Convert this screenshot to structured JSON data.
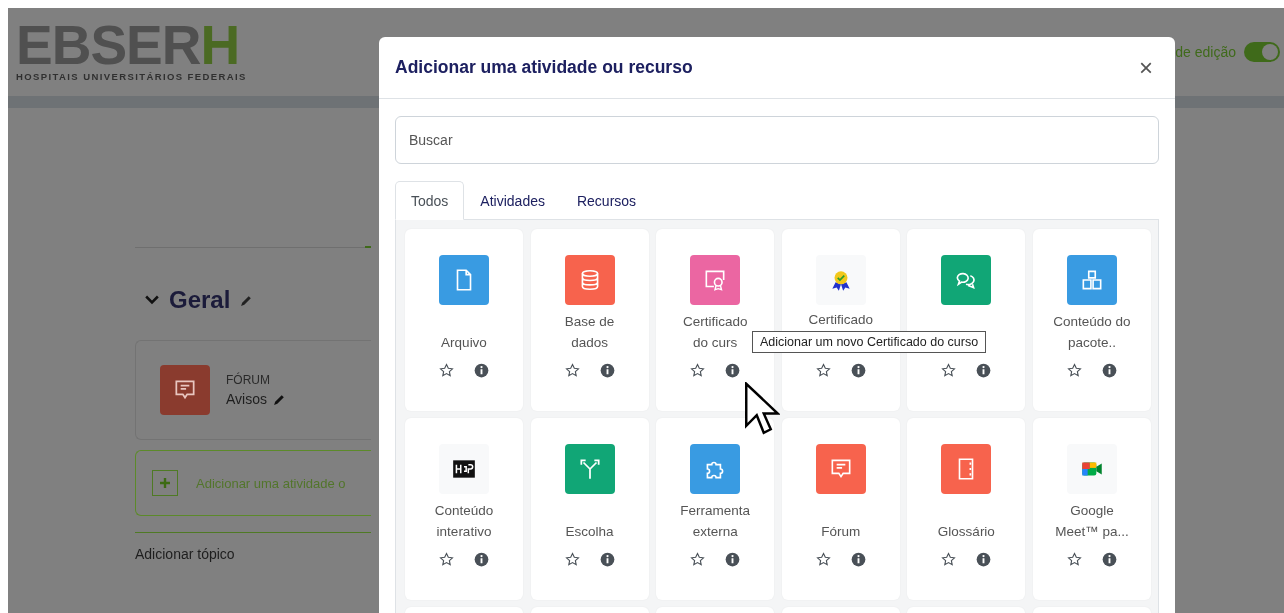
{
  "header": {
    "logo_main": "EBSER",
    "logo_accent": "H",
    "logo_subtitle": "HOSPITAIS UNIVERSITÁRIOS FEDERAIS",
    "edit_mode_label": "de edição",
    "edit_mode_on": true
  },
  "course": {
    "section_title": "Geral",
    "expanded": true,
    "activity": {
      "type": "FÓRUM",
      "name": "Avisos"
    },
    "add_activity": "Adicionar uma atividade o",
    "add_topic": "Adicionar tópico"
  },
  "modal": {
    "title": "Adicionar uma atividade ou recurso",
    "close": "×",
    "search": {
      "placeholder": "Buscar"
    },
    "tabs": [
      {
        "label": "Todos",
        "selected": true
      },
      {
        "label": "Atividades",
        "selected": false
      },
      {
        "label": "Recursos",
        "selected": false
      }
    ],
    "items": [
      {
        "kind": "file",
        "color": "#399be2",
        "name": "Arquivo",
        "favorite": false
      },
      {
        "kind": "database",
        "color": "#f7634d",
        "name": "Base de dados",
        "favorite": false
      },
      {
        "kind": "certificate",
        "color": "#eb66a2",
        "name": "Certificado do curs",
        "favorite": false
      },
      {
        "kind": "badge",
        "color": "#f8f9fa",
        "name": "Certificado",
        "partly_covered": true,
        "favorite": false
      },
      {
        "kind": "chat",
        "color": "#11a676",
        "favorite": false
      },
      {
        "kind": "package",
        "color": "#399be2",
        "name": "Conteúdo do pacote..",
        "favorite": false
      },
      {
        "kind": "h5p",
        "color": "#f8f9fa",
        "name": "Conteúdo interativo",
        "favorite": false
      },
      {
        "kind": "choice",
        "color": "#11a676",
        "name": "Escolha",
        "favorite": false
      },
      {
        "kind": "puzzle",
        "color": "#399be2",
        "name": "Ferramenta externa",
        "favorite": false
      },
      {
        "kind": "forum",
        "color": "#f7634d",
        "name": "Fórum",
        "favorite": false
      },
      {
        "kind": "glossary",
        "color": "#f7634d",
        "name": "Glossário",
        "favorite": false
      },
      {
        "kind": "meet",
        "color": "#f8f9fa",
        "name": "Google Meet™ pa...",
        "favorite": false
      }
    ],
    "tooltip": "Adicionar um novo Certificado do curso"
  }
}
